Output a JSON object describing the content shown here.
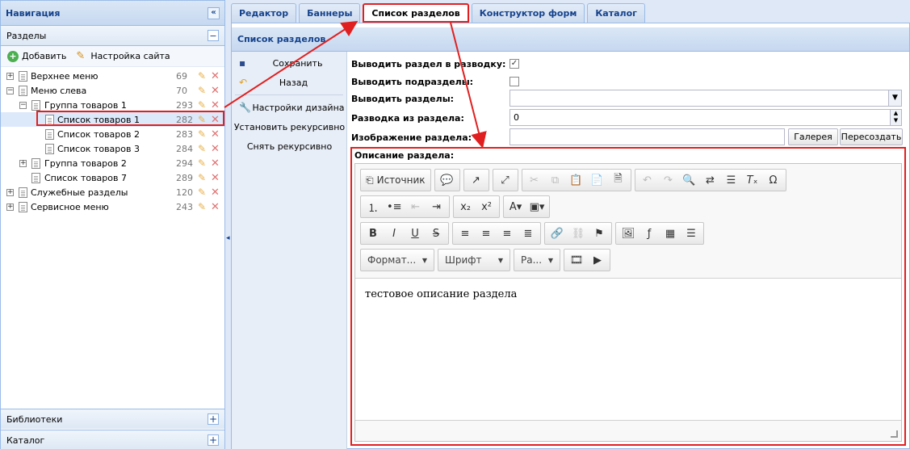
{
  "nav": {
    "title": "Навигация",
    "collapse_icon": "double-chevron-left-icon",
    "sections_title": "Разделы",
    "toolbar": {
      "add_label": "Добавить",
      "site_settings_label": "Настройка сайта"
    },
    "tree": [
      {
        "label": "Верхнее меню",
        "count": "69"
      },
      {
        "label": "Меню слева",
        "count": "70"
      },
      {
        "label": "Группа товаров 1",
        "count": "293"
      },
      {
        "label": "Список товаров 1",
        "count": "282"
      },
      {
        "label": "Список товаров 2",
        "count": "283"
      },
      {
        "label": "Список товаров 3",
        "count": "284"
      },
      {
        "label": "Группа товаров 2",
        "count": "294"
      },
      {
        "label": "Список товаров 7",
        "count": "289"
      },
      {
        "label": "Служебные разделы",
        "count": "120"
      },
      {
        "label": "Сервисное меню",
        "count": "243"
      }
    ],
    "libraries_label": "Библиотеки",
    "catalog_label": "Каталог"
  },
  "tabs": [
    "Редактор",
    "Баннеры",
    "Список разделов",
    "Конструктор форм",
    "Каталог"
  ],
  "active_tab": "Список разделов",
  "content_title": "Список разделов",
  "sidebar": {
    "save": "Сохранить",
    "back": "Назад",
    "design_settings": "Настройки дизайна",
    "set_recursive": "Установить рекурсивно",
    "remove_recursive": "Снять рекурсивно"
  },
  "form": {
    "show_in_list_label": "Выводить раздел в разводку:",
    "show_in_list_checked": true,
    "show_subsections_label": "Выводить подразделы:",
    "show_subsections_checked": false,
    "show_sections_label": "Выводить разделы:",
    "show_sections_value": "",
    "list_from_label": "Разводка из раздела:",
    "list_from_value": "0",
    "image_label": "Изображение раздела:",
    "image_value": "",
    "gallery_button": "Галерея",
    "recreate_button": "Пересоздать",
    "description_label": "Описание раздела:"
  },
  "editor": {
    "source_label": "Источник",
    "format_combo": "Формат...",
    "font_combo": "Шрифт",
    "size_combo": "Ра...",
    "content": "тестовое описание раздела"
  },
  "colors": {
    "accent": "#15428b",
    "highlight": "#e02020"
  }
}
